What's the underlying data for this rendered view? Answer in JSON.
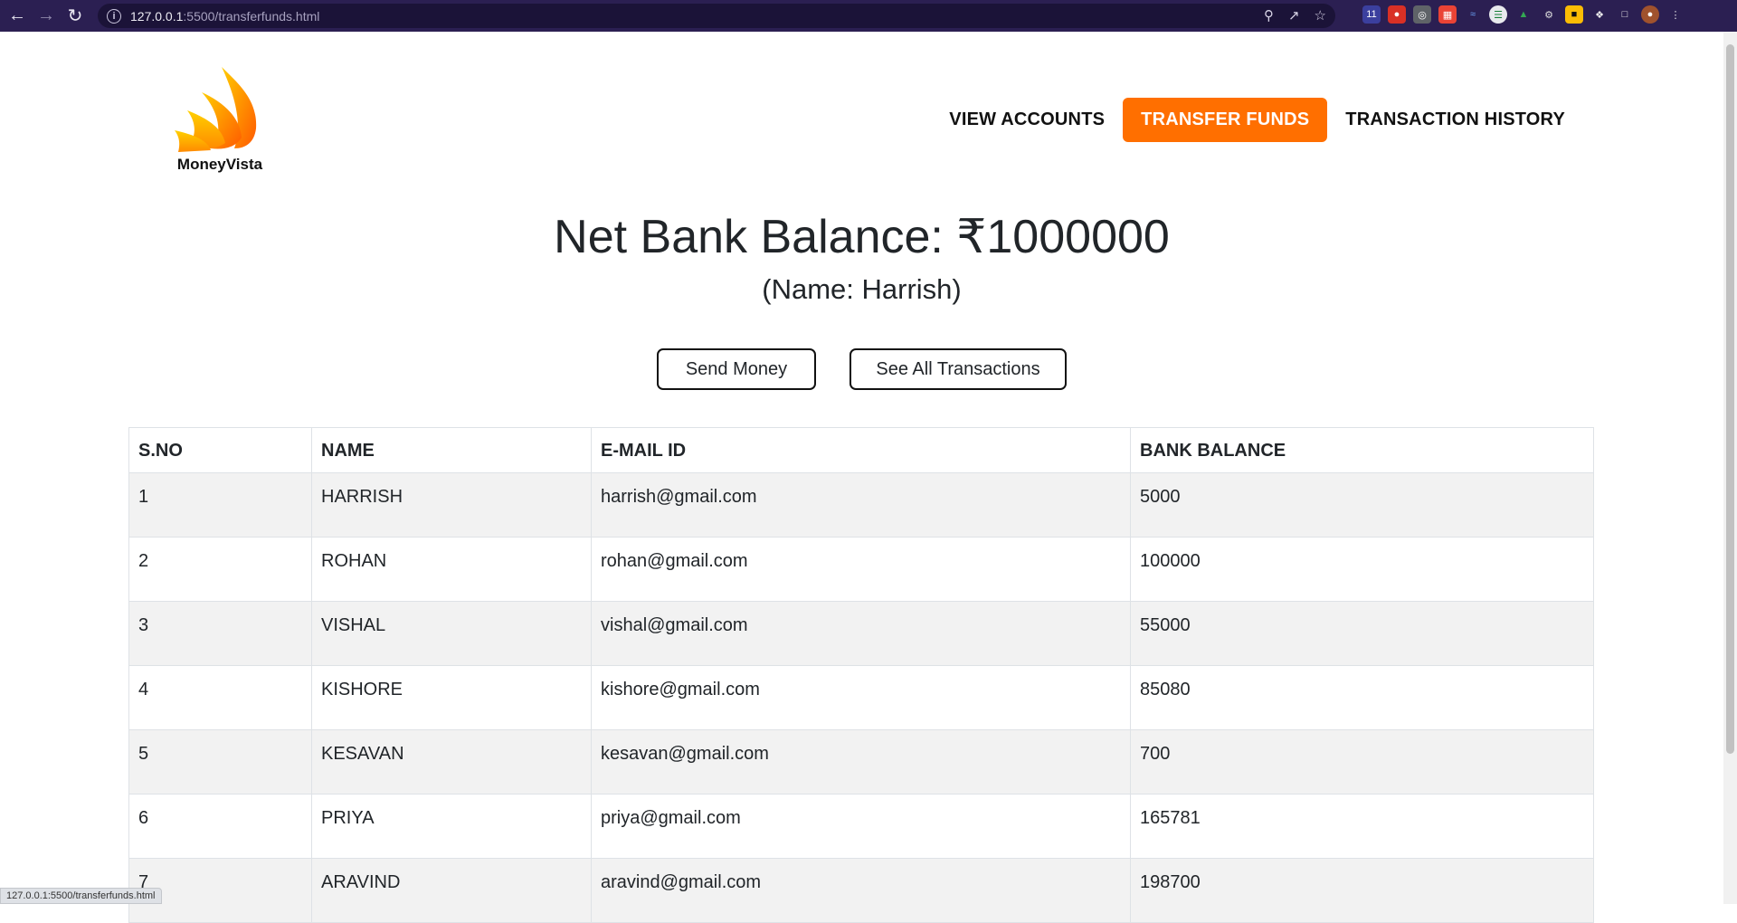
{
  "browser": {
    "url_host": "127.0.0.1",
    "url_path": ":5500/transferfunds.html",
    "status_url": "127.0.0.1:5500/transferfunds.html"
  },
  "brand": {
    "name": "MoneyVista"
  },
  "nav": {
    "items": [
      "VIEW ACCOUNTS",
      "TRANSFER FUNDS",
      "TRANSACTION HISTORY"
    ],
    "active": "TRANSFER FUNDS"
  },
  "summary": {
    "balance": "Net Bank Balance: ₹1000000",
    "name": "(Name: Harrish)"
  },
  "actions": {
    "send": "Send Money",
    "all": "See All Transactions"
  },
  "table": {
    "headers": [
      "S.NO",
      "NAME",
      "E-MAIL ID",
      "BANK BALANCE"
    ],
    "rows": [
      [
        "1",
        "HARRISH",
        "harrish@gmail.com",
        "5000"
      ],
      [
        "2",
        "ROHAN",
        "rohan@gmail.com",
        "100000"
      ],
      [
        "3",
        "VISHAL",
        "vishal@gmail.com",
        "55000"
      ],
      [
        "4",
        "KISHORE",
        "kishore@gmail.com",
        "85080"
      ],
      [
        "5",
        "KESAVAN",
        "kesavan@gmail.com",
        "700"
      ],
      [
        "6",
        "PRIYA",
        "priya@gmail.com",
        "165781"
      ],
      [
        "7",
        "ARAVIND",
        "aravind@gmail.com",
        "198700"
      ]
    ]
  },
  "colors": {
    "accent": "#ff6f00",
    "chrome": "#2b1f52"
  }
}
